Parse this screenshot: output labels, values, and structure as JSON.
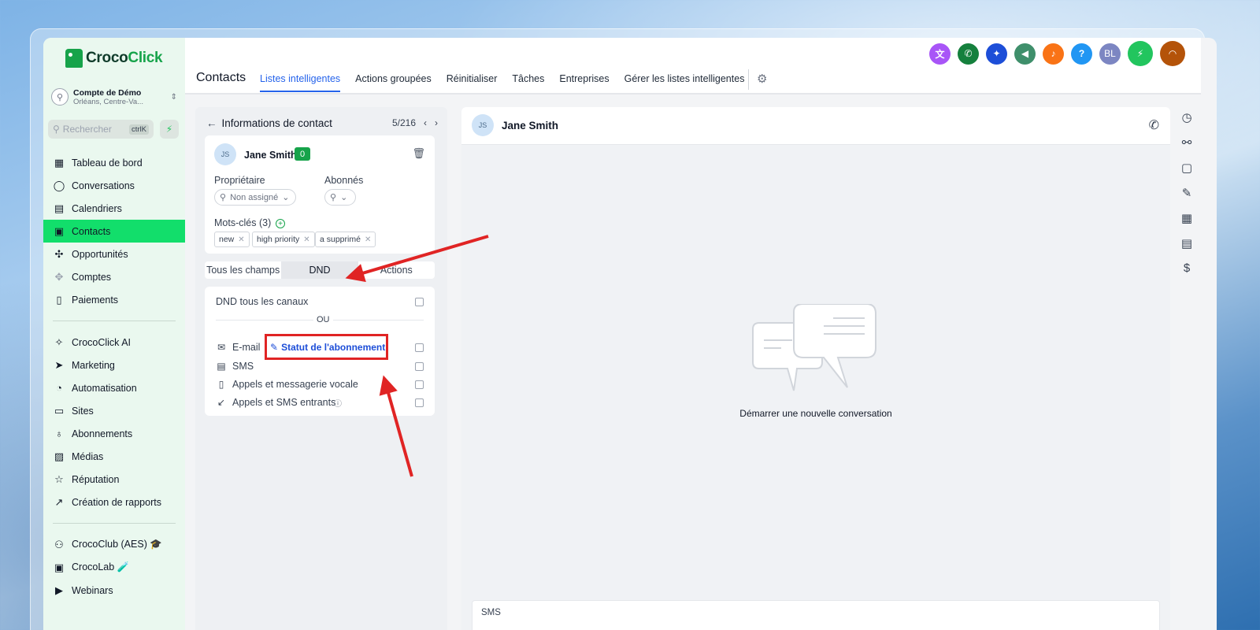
{
  "brand": {
    "name_part1": "Croco",
    "name_part2": "Click"
  },
  "account": {
    "name": "Compte de Démo",
    "location": "Orléans, Centre-Va..."
  },
  "search": {
    "placeholder": "Rechercher",
    "shortcut": "ctrlK"
  },
  "sidebar": {
    "items": [
      {
        "label": "Tableau de bord",
        "icon": "dashboard-icon",
        "glyph": "▦"
      },
      {
        "label": "Conversations",
        "icon": "chat-icon",
        "glyph": "◯"
      },
      {
        "label": "Calendriers",
        "icon": "calendar-icon",
        "glyph": "▤"
      },
      {
        "label": "Contacts",
        "icon": "contacts-icon",
        "glyph": "▣"
      },
      {
        "label": "Opportunités",
        "icon": "opportunities-icon",
        "glyph": "✣"
      },
      {
        "label": "Comptes",
        "icon": "accounts-icon",
        "glyph": "✥"
      },
      {
        "label": "Paiements",
        "icon": "payments-icon",
        "glyph": "▯"
      }
    ],
    "items2": [
      {
        "label": "CrocoClick AI",
        "icon": "sparkle-icon",
        "glyph": "✧"
      },
      {
        "label": "Marketing",
        "icon": "send-icon",
        "glyph": "➤"
      },
      {
        "label": "Automatisation",
        "icon": "automation-icon",
        "glyph": "◔"
      },
      {
        "label": "Sites",
        "icon": "sites-icon",
        "glyph": "▭"
      },
      {
        "label": "Abonnements",
        "icon": "membership-icon",
        "glyph": "♁"
      },
      {
        "label": "Médias",
        "icon": "media-icon",
        "glyph": "▨"
      },
      {
        "label": "Réputation",
        "icon": "star-icon",
        "glyph": "☆"
      },
      {
        "label": "Création de rapports",
        "icon": "trend-icon",
        "glyph": "↗"
      }
    ],
    "items3": [
      {
        "label": "CrocoClub (AES) 🎓",
        "icon": "community-icon",
        "glyph": "⚇"
      },
      {
        "label": "CrocoLab 🧪",
        "icon": "lab-icon",
        "glyph": "▣"
      },
      {
        "label": "Webinars",
        "icon": "video-icon",
        "glyph": "▶"
      }
    ]
  },
  "header": {
    "title": "Contacts",
    "tabs": [
      "Listes intelligentes",
      "Actions groupées",
      "Réinitialiser",
      "Tâches",
      "Entreprises",
      "Gérer les listes intelligentes"
    ],
    "icons": [
      {
        "name": "translate-icon",
        "glyph": "文",
        "color": "#a855f7"
      },
      {
        "name": "phone-icon",
        "glyph": "✆",
        "color": "#15803d"
      },
      {
        "name": "ai-sparkle-icon",
        "glyph": "✦",
        "color": "#1d4ed8"
      },
      {
        "name": "megaphone-icon",
        "glyph": "◀",
        "color": "#3f8f6b"
      },
      {
        "name": "bell-icon",
        "glyph": "♪",
        "color": "#f97316"
      },
      {
        "name": "help-icon",
        "glyph": "?",
        "color": "#2196f3"
      },
      {
        "name": "user-avatar",
        "glyph": "BL",
        "color": "#7c86c2"
      },
      {
        "name": "lightning-icon",
        "glyph": "⚡",
        "color": "#22c55e"
      },
      {
        "name": "headset-icon",
        "glyph": "◠",
        "color": "#b45309"
      }
    ]
  },
  "contact_panel": {
    "title": "Informations de contact",
    "pagination": "5/216",
    "contact": {
      "initials": "JS",
      "name": "Jane Smith",
      "badge": "0"
    },
    "owner_label": "Propriétaire",
    "owner_value": "Non assigné",
    "followers_label": "Abonnés",
    "tags_label": "Mots-clés (3)",
    "tags": [
      "new",
      "high priority",
      "a supprimé"
    ],
    "segments": [
      "Tous les champs",
      "DND",
      "Actions"
    ],
    "dnd": {
      "all_channels": "DND tous les canaux",
      "or": "OU",
      "rows": [
        {
          "label": "E-mail",
          "icon": "mail-icon",
          "glyph": "✉"
        },
        {
          "label": "SMS",
          "icon": "sms-icon",
          "glyph": "▤"
        },
        {
          "label": "Appels et messagerie vocale",
          "icon": "mobile-icon",
          "glyph": "▯"
        },
        {
          "label": "Appels et SMS entrants",
          "icon": "incoming-icon",
          "glyph": "↙"
        }
      ],
      "subscription_status": "Statut de l'abonnement"
    }
  },
  "conversation": {
    "initials": "JS",
    "name": "Jane Smith",
    "empty_text": "Démarrer une nouvelle conversation",
    "composer_tab": "SMS"
  },
  "rail_icons": [
    {
      "name": "history-icon",
      "glyph": "◷"
    },
    {
      "name": "workflow-icon",
      "glyph": "⚯"
    },
    {
      "name": "tasks-icon",
      "glyph": "▢"
    },
    {
      "name": "notes-icon",
      "glyph": "✎"
    },
    {
      "name": "appointments-icon",
      "glyph": "▦"
    },
    {
      "name": "documents-icon",
      "glyph": "▤"
    },
    {
      "name": "payments-icon",
      "glyph": "$"
    }
  ],
  "colors": {
    "accent_green": "#12de6b",
    "brand_green": "#16a34a",
    "link_blue": "#2563eb",
    "annotation_red": "#e02424"
  }
}
